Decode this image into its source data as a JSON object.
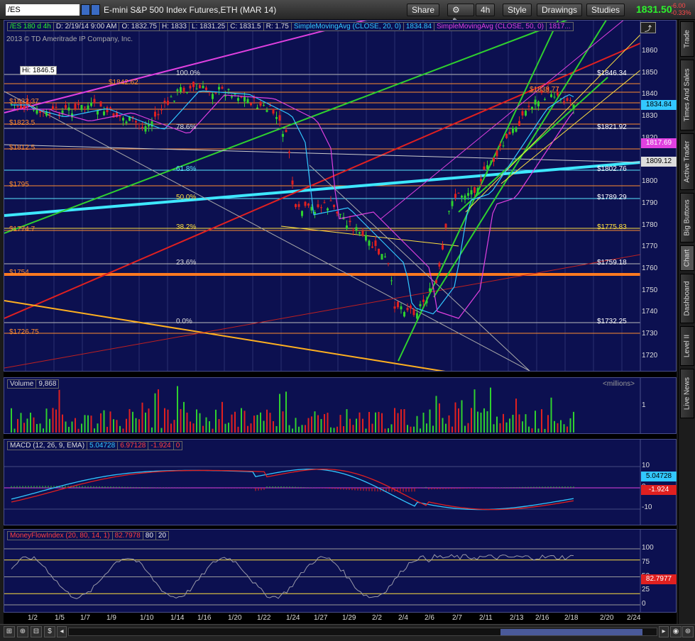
{
  "toolbar": {
    "symbol": "/ES",
    "description": "E-mini S&P 500 Index Futures,ETH (MAR 14)",
    "share": "Share",
    "period": "4h",
    "style": "Style",
    "drawings": "Drawings",
    "studies": "Studies",
    "last": "1831.50",
    "change": "-6.00",
    "change_pct": "-0.33%"
  },
  "header": {
    "studies": [
      "/ES 180 d 4h",
      "D: 2/19/14 9:00 AM",
      "O: 1832.75",
      "H: 1833",
      "L: 1831.25",
      "C: 1831.5",
      "R: 1.75",
      "SimpleMovingAvg (CLOSE, 20, 0)",
      "1834.84",
      "SimpleMovingAvg (CLOSE, 50, 0)",
      "1817..."
    ],
    "copyright": "2013 © TD Ameritrade IP Company, Inc.",
    "hi": "Hi: 1846.5"
  },
  "price_axis": {
    "ticks": [
      "1860",
      "1850",
      "1840",
      "1830",
      "1820",
      "1810",
      "1800",
      "1790",
      "1780",
      "1770",
      "1760",
      "1750",
      "1740",
      "1730",
      "1720"
    ],
    "tags": {
      "sma20": "1834.84",
      "sma50": "1817.69",
      "white": "1809.12"
    }
  },
  "left_levels": [
    "$1842.62",
    "$1832.37",
    "$1823.5",
    "$1812.5",
    "$1795",
    "$1774.7",
    "$1754",
    "$1726.75"
  ],
  "fib": {
    "labels": [
      "100.0%",
      "78.6%",
      "61.8%",
      "50.0%",
      "38.2%",
      "23.6%",
      "0.0%"
    ],
    "prices": [
      "$1846.34",
      "$1821.92",
      "$1802.76",
      "$1789.29",
      "$1775.83",
      "$1759.18",
      "$1732.25"
    ],
    "peak": "$1838.77"
  },
  "volume": {
    "label": "Volume",
    "value": "9,868",
    "unit": "<millions>",
    "ticks": [
      "1"
    ]
  },
  "macd": {
    "label": "MACD (12, 26, 9, EMA)",
    "value": "5.04728",
    "avg": "6.97128",
    "diff": "-1.924",
    "extra": "0",
    "ticks": [
      "10",
      "0",
      "-10"
    ],
    "tag1": "5.04728",
    "tag2": "-1.924"
  },
  "mfi": {
    "label": "MoneyFlowIndex (20, 80, 14, 1)",
    "value": "82.7978",
    "over": "80",
    "under": "20",
    "ticks": [
      "100",
      "75",
      "50",
      "25",
      "0"
    ],
    "tag": "82.7977"
  },
  "xaxis": [
    "1/2",
    "1/5",
    "1/7",
    "1/9",
    "1/10",
    "1/14",
    "1/16",
    "1/20",
    "1/22",
    "1/24",
    "1/27",
    "1/29",
    "2/2",
    "2/4",
    "2/6",
    "2/7",
    "2/11",
    "2/13",
    "2/16",
    "2/18",
    "2/20",
    "2/24"
  ],
  "sidebar": [
    "Trade",
    "Times And Sales",
    "Active Trader",
    "Big Buttons",
    "Chart",
    "Dashboard",
    "Level II",
    "Live News"
  ],
  "colors": {
    "bg": "#0c1050",
    "up": "#2fd02f",
    "down": "#e02020",
    "sma20": "#32c8ff",
    "sma50": "#e040e0"
  }
}
